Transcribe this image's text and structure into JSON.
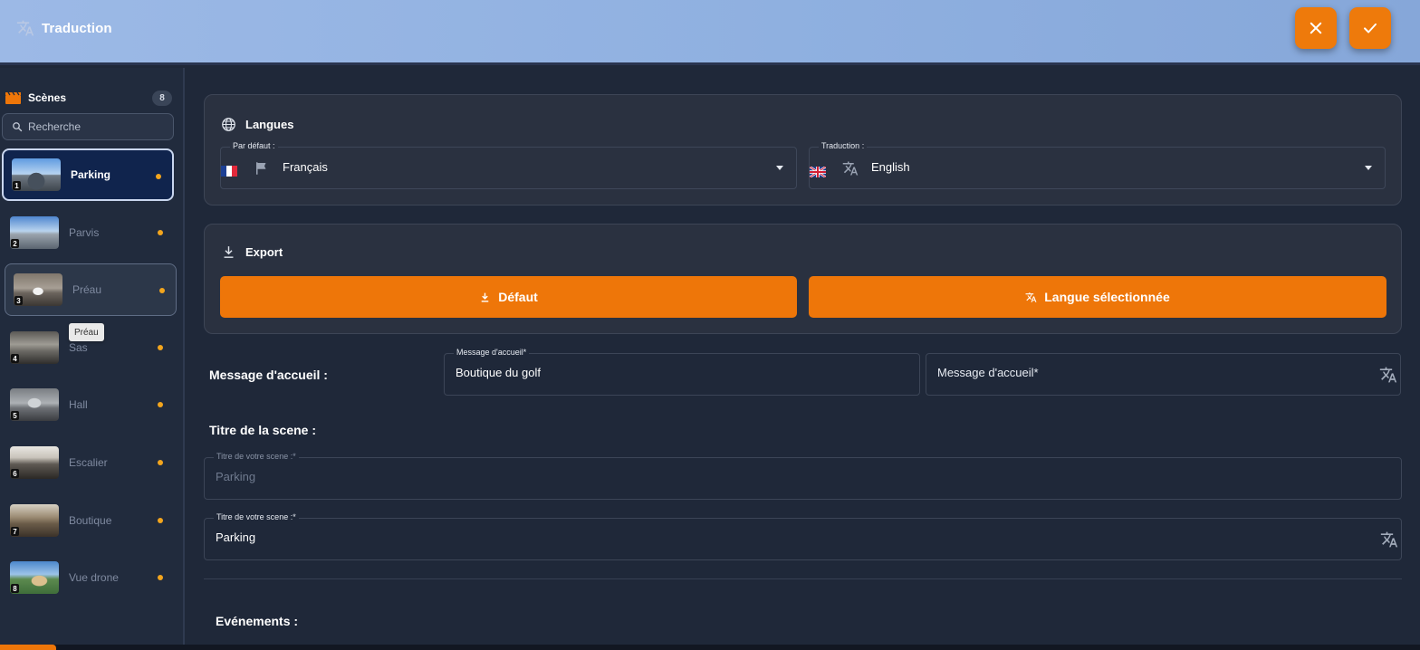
{
  "header": {
    "title": "Traduction",
    "close_icon": "close-icon",
    "confirm_icon": "check-icon"
  },
  "sidebar": {
    "title": "Scènes",
    "count": "8",
    "search_placeholder": "Recherche",
    "tooltip": "Préau",
    "scenes": [
      {
        "num": "1",
        "name": "Parking"
      },
      {
        "num": "2",
        "name": "Parvis"
      },
      {
        "num": "3",
        "name": "Préau"
      },
      {
        "num": "4",
        "name": "Sas"
      },
      {
        "num": "5",
        "name": "Hall"
      },
      {
        "num": "6",
        "name": "Escalier"
      },
      {
        "num": "7",
        "name": "Boutique"
      },
      {
        "num": "8",
        "name": "Vue drone"
      }
    ]
  },
  "langues": {
    "title": "Langues",
    "default_legend": "Par défaut :",
    "default_value": "Français",
    "translation_legend": "Traduction :",
    "translation_value": "English"
  },
  "export": {
    "title": "Export",
    "default_button": "Défaut",
    "selected_button": "Langue sélectionnée"
  },
  "welcome": {
    "label": "Message d'accueil :",
    "source_legend": "Message d'accueil*",
    "source_value": "Boutique du golf",
    "target_placeholder": "Message d'accueil*"
  },
  "scene_title": {
    "label": "Titre de la scene :",
    "source_legend": "Titre de votre scene :*",
    "source_value": "Parking",
    "target_legend": "Titre de votre scene :*",
    "target_value": "Parking"
  },
  "events": {
    "label": "Evénements :"
  },
  "colors": {
    "accent": "#ee7609",
    "background": "#1f2839",
    "panel": "#2a3140",
    "active_scene": "#10244d",
    "status_dot": "#f3a51d"
  }
}
